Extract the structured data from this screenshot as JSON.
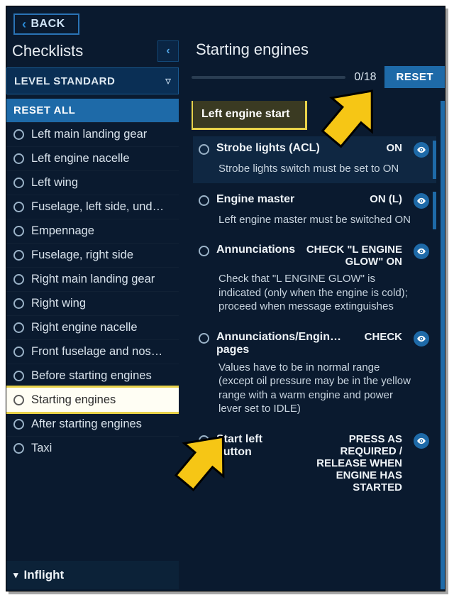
{
  "back_label": "BACK",
  "sidebar": {
    "title": "Checklists",
    "level_label": "LEVEL STANDARD",
    "reset_all_label": "RESET ALL",
    "items": [
      "Left main landing gear",
      "Left engine nacelle",
      "Left wing",
      "Fuselage, left side, und…",
      "Empennage",
      "Fuselage, right side",
      "Right main landing gear",
      "Right wing",
      "Right engine nacelle",
      "Front fuselage and nos…",
      "Before starting engines",
      "Starting engines",
      "After starting engines",
      "Taxi"
    ],
    "selected_index": 11,
    "section_label": "Inflight"
  },
  "main": {
    "title": "Starting engines",
    "progress": {
      "done": 0,
      "total": 18
    },
    "reset_label": "RESET",
    "group_title": "Left engine start",
    "items": [
      {
        "name": "Strobe lights (ACL)",
        "value": "ON",
        "desc": "Strobe lights switch must be set to ON",
        "shade": true,
        "scroll": true
      },
      {
        "name": "Engine master",
        "value": "ON (L)",
        "desc": "Left engine master must be switched ON",
        "shade": false,
        "scroll": true
      },
      {
        "name": "Annunciations",
        "value": "CHECK \"L ENGINE GLOW\" ON",
        "desc": "Check that \"L ENGINE GLOW\" is indicated (only when the engine is cold); proceed when message extinguishes",
        "shade": false,
        "scroll": false
      },
      {
        "name": "Annunciations/Engin… pages",
        "value": "CHECK",
        "desc": "Values have to be in normal range (except oil pressure may be in the yellow range with a warm engine and power lever set to IDLE)",
        "shade": false,
        "scroll": false
      },
      {
        "name": "Start left button",
        "value": "PRESS AS REQUIRED / RELEASE WHEN ENGINE HAS STARTED",
        "desc": "",
        "shade": false,
        "scroll": false
      }
    ]
  }
}
